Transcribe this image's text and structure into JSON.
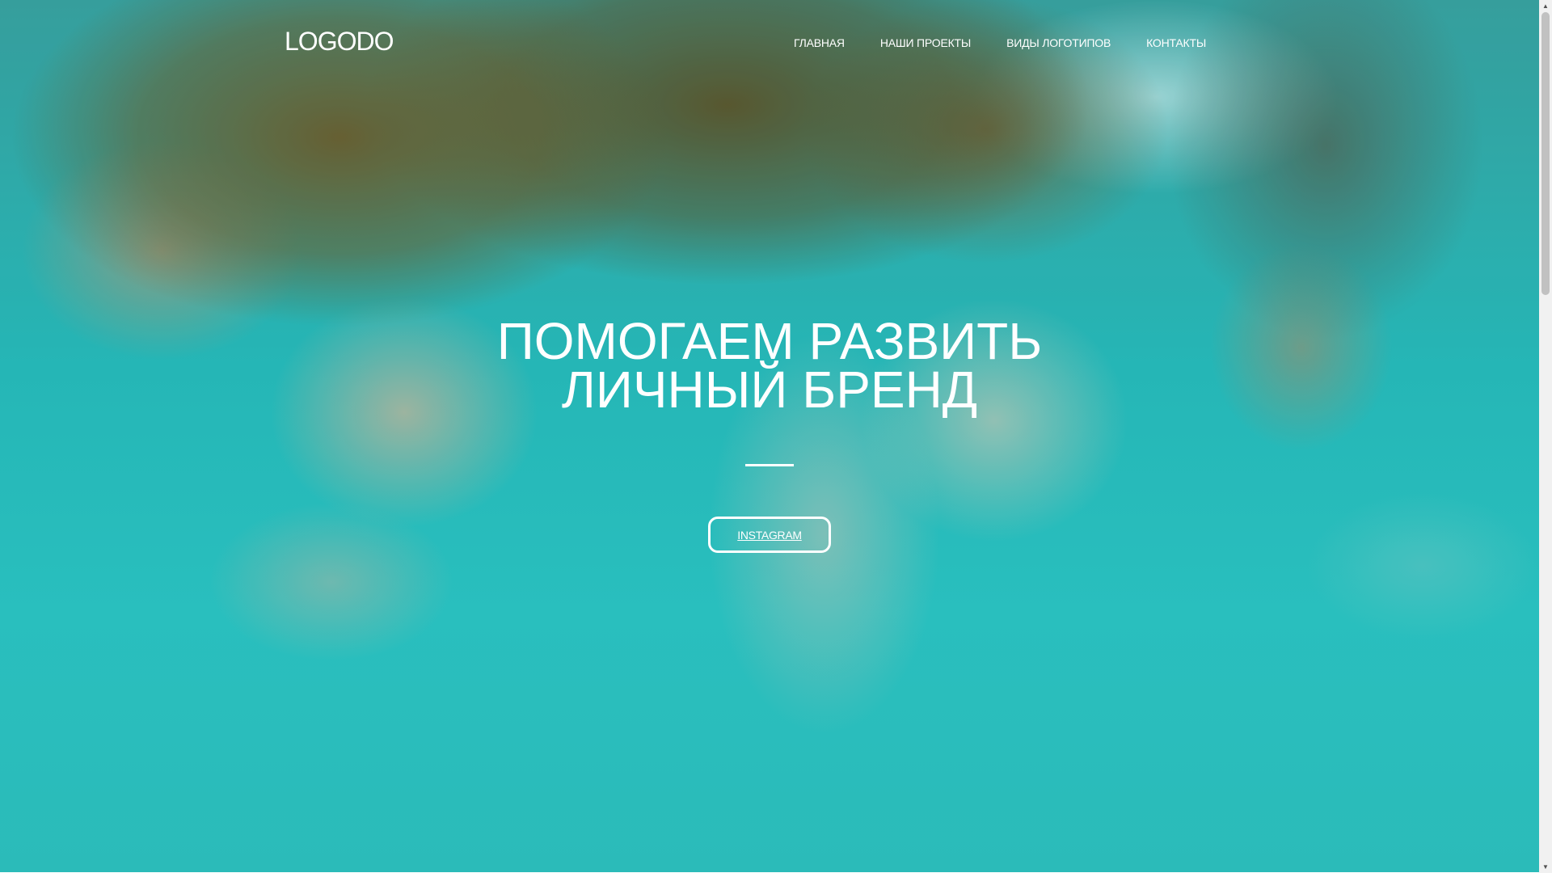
{
  "header": {
    "logo": "LOGODO",
    "nav": [
      {
        "label": "ГЛАВНАЯ"
      },
      {
        "label": "НАШИ ПРОЕКТЫ"
      },
      {
        "label": "ВИДЫ ЛОГОТИПОВ"
      },
      {
        "label": "КОНТАКТЫ"
      }
    ]
  },
  "hero": {
    "title_line1": "ПОМОГАЕМ РАЗВИТЬ",
    "title_line2": "ЛИЧНЫЙ БРЕНД",
    "button": "INSTAGRAM",
    "background": "blurred aerial coastline photo",
    "colors": {
      "water": "#2cc7c6",
      "foliage": "#6b5c2a",
      "text": "#ffffff"
    }
  },
  "scrollbar": {
    "up_icon": "scroll-up-arrow-icon",
    "down_icon": "scroll-down-arrow-icon"
  }
}
